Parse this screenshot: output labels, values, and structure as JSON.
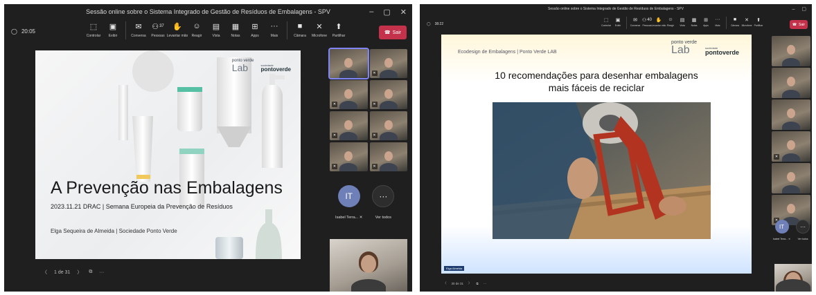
{
  "window1": {
    "title": "Sessão online sobre o Sistema Integrado de Gestão de Resíduos de Embalagens - SPV",
    "elapsed": "20:05",
    "tools": [
      {
        "label": "Controlar",
        "icon": "control-icon"
      },
      {
        "label": "Exibir",
        "icon": "view-icon"
      },
      {
        "label": "Conversa",
        "icon": "chat-icon"
      },
      {
        "label": "Pessoas",
        "icon": "people-icon",
        "count": "37"
      },
      {
        "label": "Levantar mão",
        "icon": "raise-hand-icon"
      },
      {
        "label": "Reagir",
        "icon": "react-icon"
      },
      {
        "label": "Vista",
        "icon": "view-layout-icon"
      },
      {
        "label": "Notas",
        "icon": "notes-icon"
      },
      {
        "label": "Apps",
        "icon": "apps-icon"
      },
      {
        "label": "Mais",
        "icon": "more-icon"
      },
      {
        "label": "Câmara",
        "icon": "camera-icon"
      },
      {
        "label": "Microfone",
        "icon": "mic-off-icon"
      },
      {
        "label": "Partilhar",
        "icon": "share-icon"
      }
    ],
    "leave_label": "Sair",
    "slide": {
      "brand_lab_top": "ponto verde",
      "brand_lab": "Lab",
      "brand_sub": "sociedade",
      "brand_name": "pontoverde",
      "title": "A Prevenção nas Embalagens",
      "subtitle": "2023.11.21 DRAC | Semana Europeia da Prevenção de Resíduos",
      "author": "Elga Sequeira de Almeida | Sociedade Ponto Verde"
    },
    "pager": "1 de 31",
    "participant_initials": "IT",
    "participant_name": "Isabel Terra...",
    "more_label": "Ver todos"
  },
  "window2": {
    "title": "Sessão online sobre o Sistema Integrado de Gestão de Resíduos de Embalagens - SPV",
    "elapsed": "38:22",
    "tools": [
      {
        "label": "Controlar",
        "icon": "control-icon"
      },
      {
        "label": "Exibir",
        "icon": "view-icon"
      },
      {
        "label": "Conversa",
        "icon": "chat-icon"
      },
      {
        "label": "Pessoas",
        "icon": "people-icon",
        "count": "40"
      },
      {
        "label": "Levantar mão",
        "icon": "raise-hand-icon"
      },
      {
        "label": "Reagir",
        "icon": "react-icon"
      },
      {
        "label": "Vista",
        "icon": "view-layout-icon"
      },
      {
        "label": "Notas",
        "icon": "notes-icon"
      },
      {
        "label": "Apps",
        "icon": "apps-icon"
      },
      {
        "label": "Mais",
        "icon": "more-icon"
      },
      {
        "label": "Câmara",
        "icon": "camera-icon"
      },
      {
        "label": "Microfone",
        "icon": "mic-off-icon"
      },
      {
        "label": "Partilhar",
        "icon": "share-icon"
      }
    ],
    "leave_label": "Sair",
    "slide": {
      "header": "Ecodesign de Embalagens | Ponto Verde LAB",
      "brand_lab_top": "ponto verde",
      "brand_lab": "Lab",
      "brand_sub": "sociedade",
      "brand_name": "pontoverde",
      "title_line1": "10 recomendações para desenhar embalagens",
      "title_line2": "mais fáceis de reciclar",
      "presenter_tag": "Elga Almeida"
    },
    "pager": "30 de 31",
    "participant_initials": "IT",
    "participant_name": "Isabel Terra...",
    "more_label": "Ver todos"
  },
  "colors": {
    "leave": "#c4314b",
    "teams_purple": "#7f85f5",
    "tape_gun": "#b2331f"
  }
}
